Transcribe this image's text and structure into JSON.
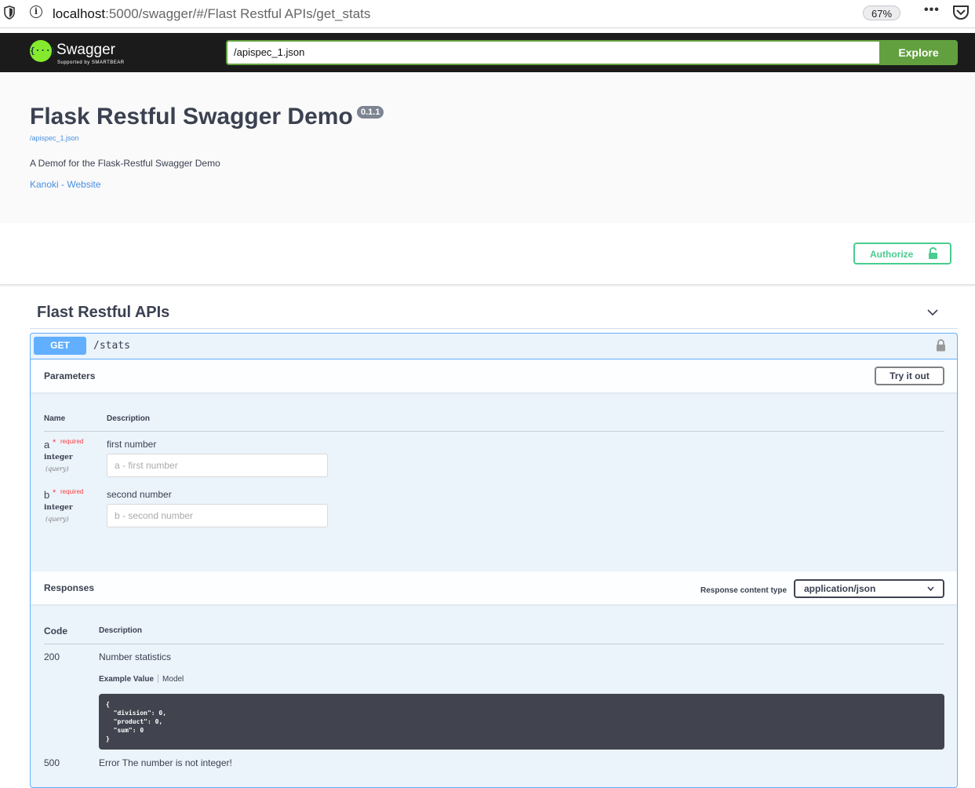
{
  "browser": {
    "url_host": "localhost",
    "url_path": ":5000/swagger/#/Flast Restful APIs/get_stats",
    "zoom": "67%",
    "more_icon": "•••"
  },
  "topbar": {
    "logo_mark": "{···}",
    "logo_text": "Swagger",
    "logo_sub": "Supported by SMARTBEAR",
    "spec_url": "/apispec_1.json",
    "explore_label": "Explore"
  },
  "info": {
    "title": "Flask Restful Swagger Demo",
    "version": "0.1.1",
    "spec_link": "/apispec_1.json",
    "description": "A Demof for the Flask-Restful Swagger Demo",
    "site_link": "Kanoki - Website"
  },
  "auth": {
    "label": "Authorize"
  },
  "tag": {
    "title": "Flast Restful APIs"
  },
  "operation": {
    "method": "GET",
    "path": "/stats",
    "parameters_title": "Parameters",
    "try_label": "Try it out",
    "col_name": "Name",
    "col_description": "Description",
    "params": [
      {
        "name": "a",
        "star": "*",
        "required": "required",
        "type": "integer",
        "in": "(query)",
        "description": "first number",
        "placeholder": "a - first number"
      },
      {
        "name": "b",
        "star": "*",
        "required": "required",
        "type": "integer",
        "in": "(query)",
        "description": "second number",
        "placeholder": "b - second number"
      }
    ],
    "responses_title": "Responses",
    "content_type_label": "Response content type",
    "content_type_value": "application/json",
    "col_code": "Code",
    "col_res_description": "Description",
    "responses": [
      {
        "code": "200",
        "description": "Number statistics",
        "tab_example": "Example Value",
        "tab_model": "Model",
        "example": "{\n  \"division\": 0,\n  \"product\": 0,\n  \"sum\": 0\n}"
      },
      {
        "code": "500",
        "description": "Error The number is not integer!"
      }
    ]
  },
  "colors": {
    "get": "#61affe",
    "green": "#49cc90",
    "explore": "#62a03f",
    "topbar": "#1b1b1b"
  }
}
